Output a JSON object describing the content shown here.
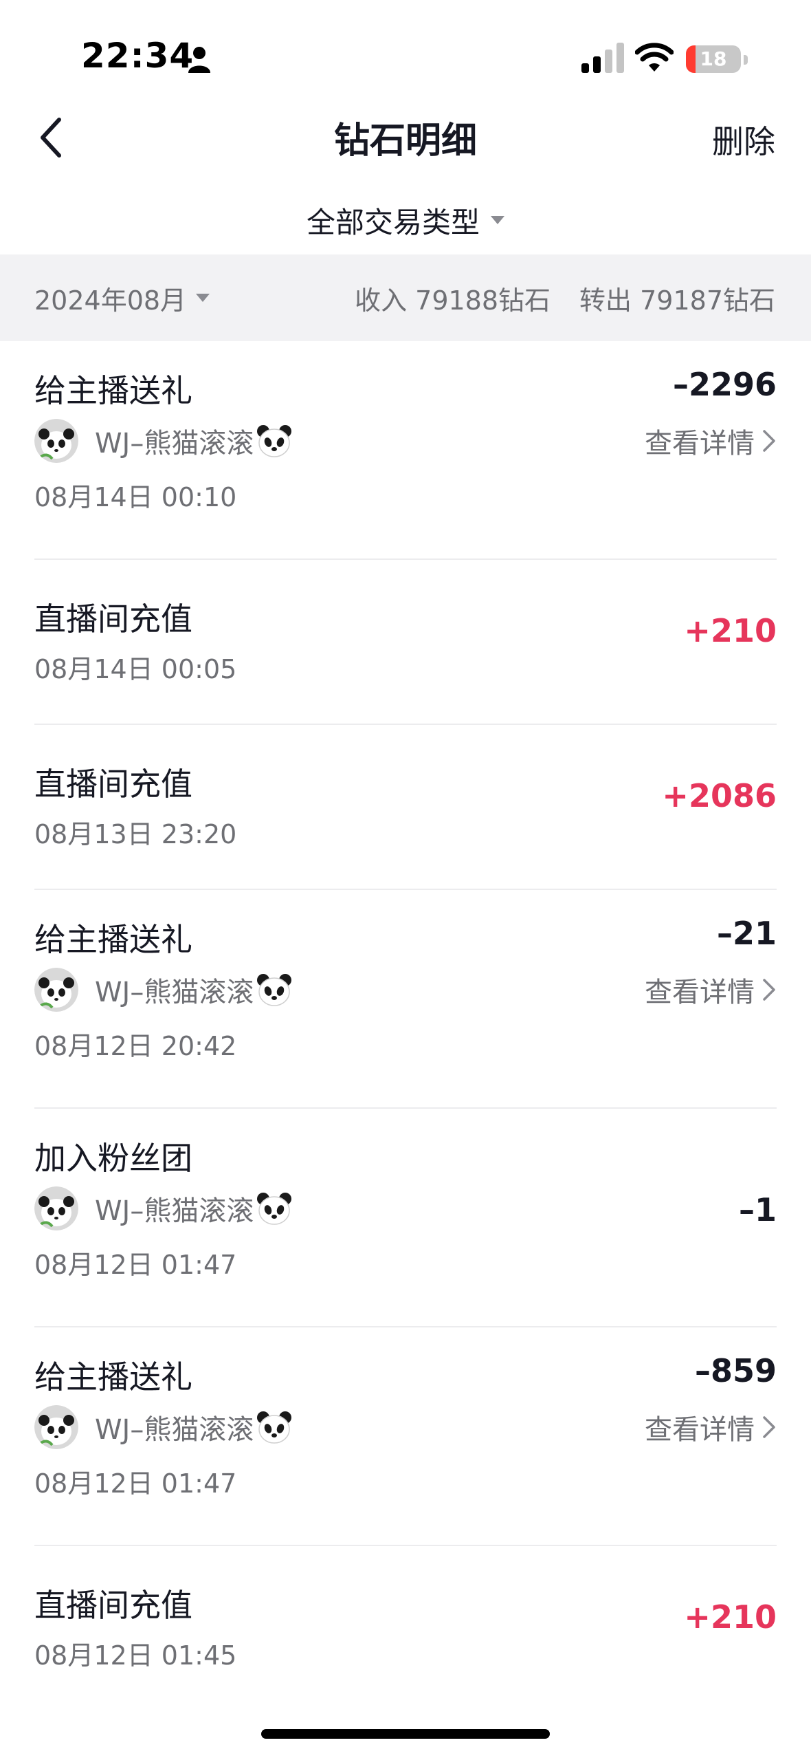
{
  "status_bar": {
    "time": "22:34",
    "battery": "18",
    "battery_level": 0.18,
    "icons": [
      "person-icon",
      "cellular-signal-icon",
      "wifi-icon",
      "battery-icon"
    ]
  },
  "nav": {
    "title": "钻石明细",
    "delete_label": "删除",
    "back_icon": "chevron-left-icon"
  },
  "filter": {
    "label": "全部交易类型",
    "icon": "caret-down-icon"
  },
  "summary": {
    "month": "2024年08月",
    "income": "收入 79188钻石",
    "outgoing": "转出 79187钻石"
  },
  "colors": {
    "positive": "#e6355b",
    "text_primary": "#161823",
    "text_secondary": "#6e6f74",
    "summary_bg": "#f2f2f4"
  },
  "transactions": [
    {
      "title": "给主播送礼",
      "amount": "–2296",
      "sign": "negative",
      "streamer": "WJ–熊猫滚滚",
      "details": "查看详情",
      "date": "08月14日 00:10"
    },
    {
      "title": "直播间充值",
      "amount": "+210",
      "sign": "positive",
      "date": "08月14日 00:05"
    },
    {
      "title": "直播间充值",
      "amount": "+2086",
      "sign": "positive",
      "date": "08月13日 23:20"
    },
    {
      "title": "给主播送礼",
      "amount": "–21",
      "sign": "negative",
      "streamer": "WJ–熊猫滚滚",
      "details": "查看详情",
      "date": "08月12日 20:42"
    },
    {
      "title": "加入粉丝团",
      "amount": "–1",
      "sign": "negative",
      "streamer": "WJ–熊猫滚滚",
      "date": "08月12日 01:47"
    },
    {
      "title": "给主播送礼",
      "amount": "–859",
      "sign": "negative",
      "streamer": "WJ–熊猫滚滚",
      "details": "查看详情",
      "date": "08月12日 01:47"
    },
    {
      "title": "直播间充值",
      "amount": "+210",
      "sign": "positive",
      "date": "08月12日 01:45"
    }
  ]
}
